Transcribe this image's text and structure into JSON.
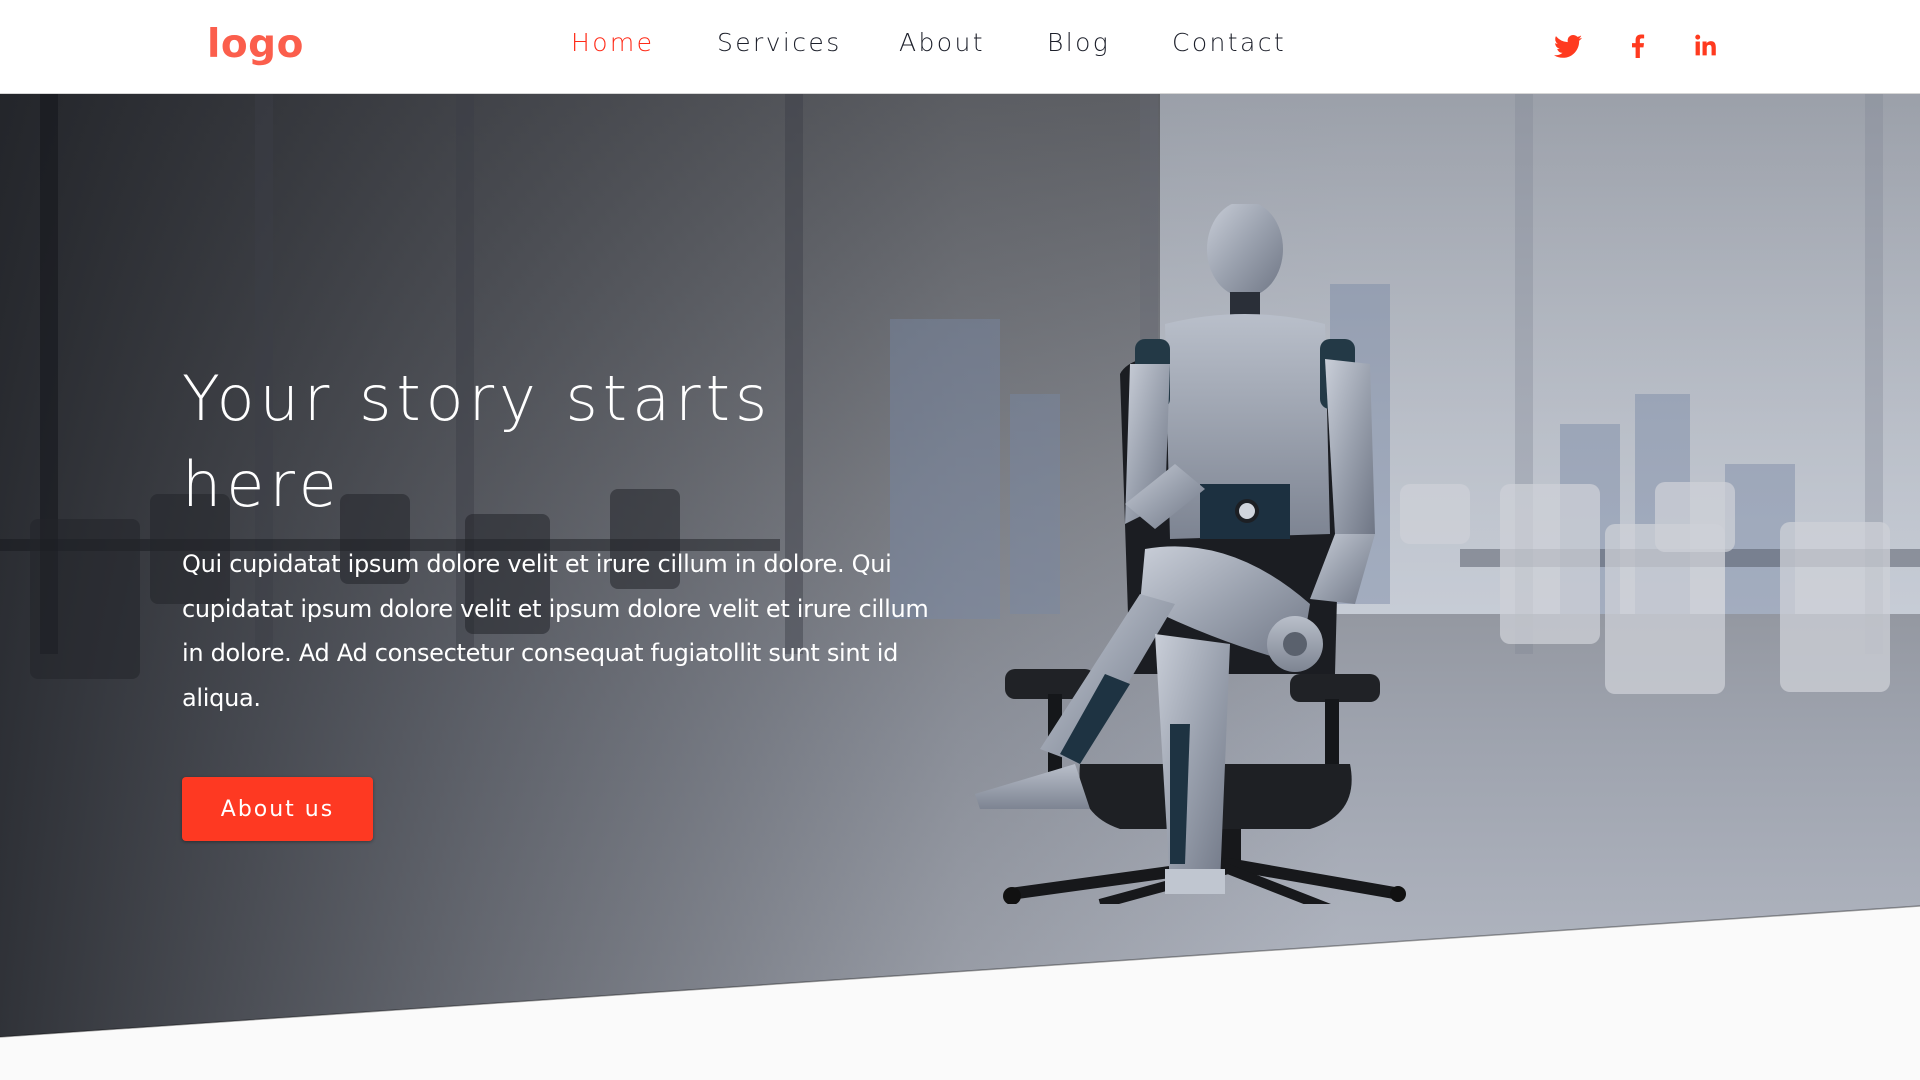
{
  "header": {
    "logo": "logo",
    "nav": [
      {
        "label": "Home",
        "active": true
      },
      {
        "label": "Services",
        "active": false
      },
      {
        "label": "About",
        "active": false
      },
      {
        "label": "Blog",
        "active": false
      },
      {
        "label": "Contact",
        "active": false
      }
    ],
    "social": [
      {
        "name": "twitter-icon"
      },
      {
        "name": "facebook-icon"
      },
      {
        "name": "linkedin-icon"
      }
    ]
  },
  "hero": {
    "title": "Your story starts here",
    "body": "Qui cupidatat ipsum dolore velit et irure cillum in dolore. Qui cupidatat ipsum dolore velit et ipsum dolore velit et irure cillum in dolore. Ad Ad consectetur consequat fugiatollit sunt sint id aliqua.",
    "button_label": "About us",
    "image_subject": "humanoid robot seated in office chair in conference room"
  },
  "colors": {
    "accent": "#fe3922",
    "logo": "#fb5e4c",
    "nav_active": "#ff2a17",
    "nav_text": "#1c1f2a",
    "page_bg": "#fafafa"
  }
}
